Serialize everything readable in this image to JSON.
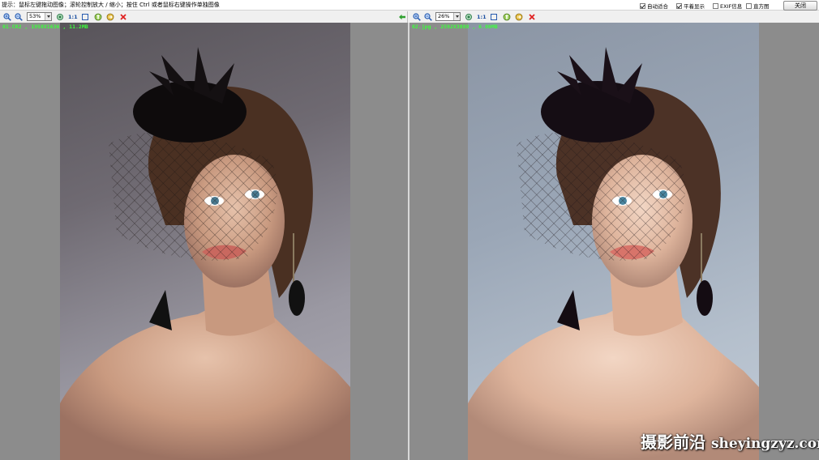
{
  "topbar": {
    "hint": "提示：鼠标左键拖动图像；滚轮控制放大 / 缩小；按住 Ctrl 或者鼠标右键操作单独图像",
    "options": [
      {
        "label": "自动适合",
        "checked": true
      },
      {
        "label": "平着显示",
        "checked": true
      },
      {
        "label": "EXIF信息",
        "checked": false
      },
      {
        "label": "直方图",
        "checked": false
      }
    ],
    "close_label": "关闭"
  },
  "left_pane": {
    "zoom": "53%",
    "one_to_one": "1:1",
    "info": "01.CR2 , 1958X1636 , 11.2MB"
  },
  "right_pane": {
    "zoom": "26%",
    "one_to_one": "1:1",
    "info": "02.jpg , 2592X3888 , 6.80MB"
  },
  "watermark": {
    "cn": "摄影前沿",
    "en": "sheyingzyz.com"
  },
  "colors": {
    "info_text": "#3cff3c",
    "viewer_bg": "#8c8c8c",
    "close_icon": "#e02020",
    "zoom_icon": "#2a5db0"
  },
  "icons": [
    "zoom-in-icon",
    "zoom-out-icon",
    "fit-icon",
    "fit-window-icon",
    "rotate-icon",
    "flip-icon",
    "delete-icon",
    "back-arrow-icon"
  ]
}
